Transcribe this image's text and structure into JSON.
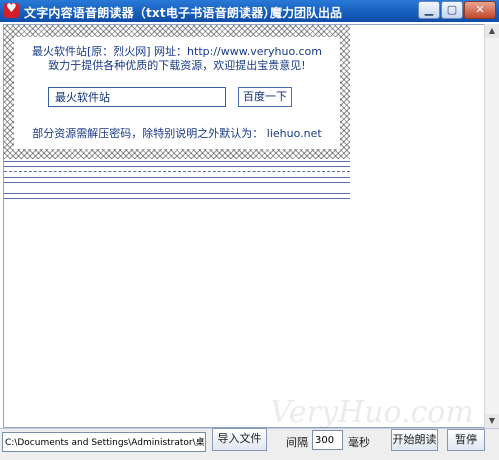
{
  "titlebar": {
    "title": "文字内容语音朗读器（txt电子书语音朗读器）",
    "brand": "魔力团队出品",
    "minimize": "▁",
    "maximize": "▢",
    "close": "✕"
  },
  "banner": {
    "line1": "最火软件站[原：烈火网] 网址：http://www.veryhuo.com",
    "line2": "致力于提供各种优质的下载资源，欢迎提出宝贵意见!",
    "search_value": "最火软件站",
    "search_button": "百度一下",
    "line3": "部分资源需解压密码，除特别说明之外默认为： liehuo.net"
  },
  "scrollbar": {
    "up": "▲",
    "down": "▼"
  },
  "bottom": {
    "path_value": "C:\\Documents and Settings\\Administrator\\桌面",
    "import_button": "导入文件",
    "interval_label": "间隔",
    "interval_value": "300",
    "ms_label": "毫秒",
    "start_button": "开始朗读",
    "pause_button": "暂停"
  },
  "watermark": "VeryHuo.com"
}
